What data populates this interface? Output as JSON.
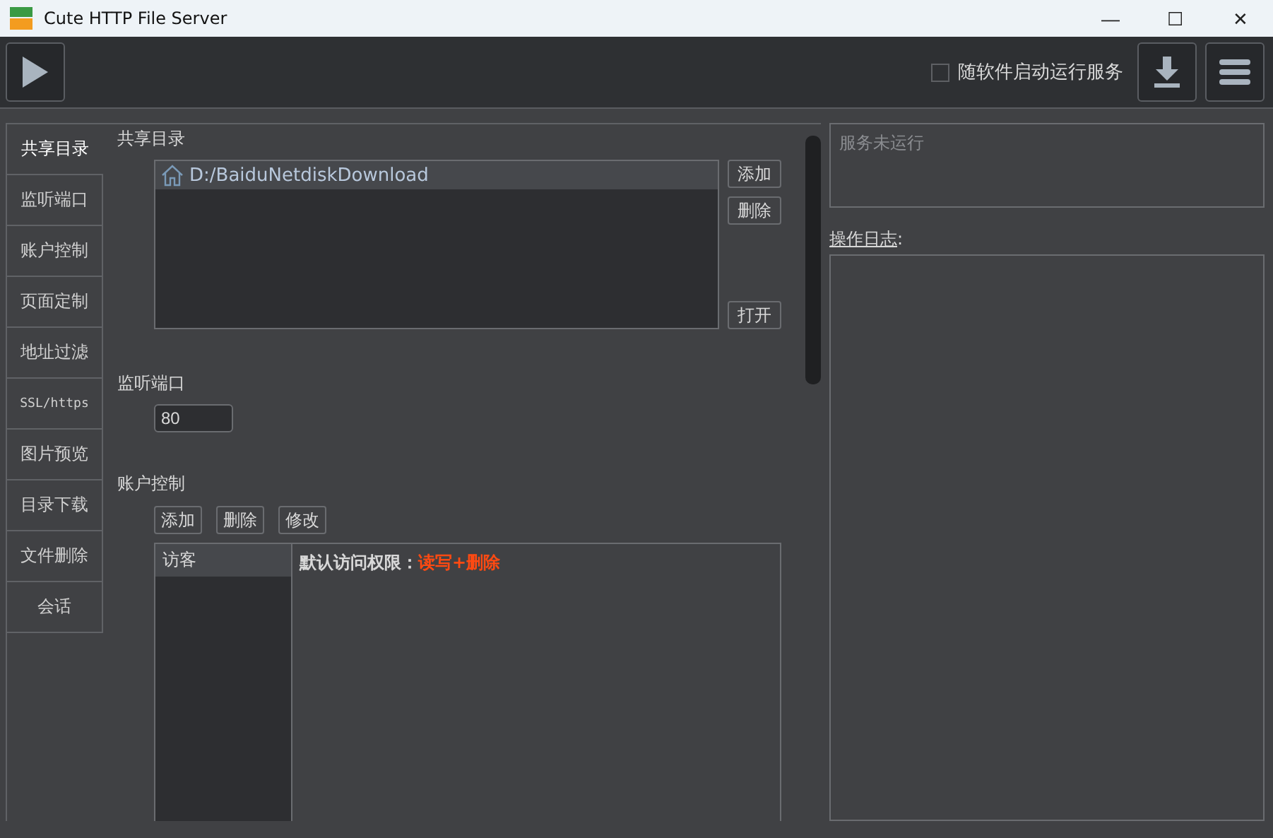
{
  "window": {
    "title": "Cute HTTP File Server",
    "controls": [
      "—",
      "☐",
      "✕"
    ]
  },
  "toolbar": {
    "autostart": {
      "label": "随软件启动运行服务",
      "checked": false
    }
  },
  "tabs": [
    {
      "label": "共享目录",
      "selected": true
    },
    {
      "label": "监听端口",
      "selected": false
    },
    {
      "label": "账户控制",
      "selected": false
    },
    {
      "label": "页面定制",
      "selected": false
    },
    {
      "label": "地址过滤",
      "selected": false
    },
    {
      "label": "SSL/https",
      "selected": false
    },
    {
      "label": "图片预览",
      "selected": false
    },
    {
      "label": "目录下载",
      "selected": false
    },
    {
      "label": "文件删除",
      "selected": false
    },
    {
      "label": "会话",
      "selected": false
    }
  ],
  "shared": {
    "title": "共享目录",
    "folders": [
      {
        "path": "D:/BaiduNetdiskDownload",
        "selected": true
      }
    ],
    "buttons": [
      "添加",
      "删除",
      "打开"
    ]
  },
  "port": {
    "title": "监听端口",
    "value": "80"
  },
  "accounts": {
    "title": "账户控制",
    "buttons": [
      "添加",
      "删除",
      "修改"
    ],
    "users": [
      {
        "name": "访客",
        "selected": true
      }
    ],
    "permission_label": "默认访问权限：",
    "permission_value": "读写+删除"
  },
  "status": {
    "text": "服务未运行"
  },
  "log": {
    "title": "操作日志",
    "colon": ":"
  }
}
